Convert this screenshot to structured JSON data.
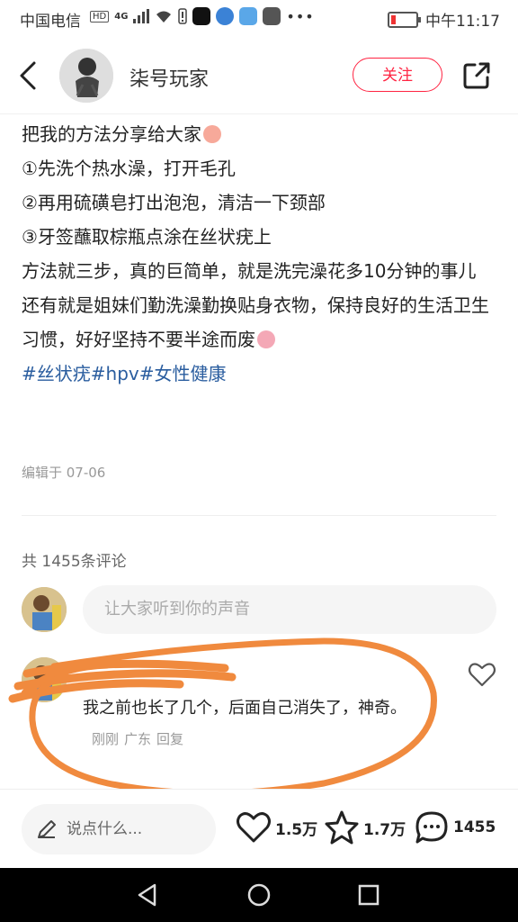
{
  "status_bar": {
    "carrier": "中国电信",
    "hd": "HD",
    "network": "4G",
    "time": "中午11:17"
  },
  "header": {
    "username": "柒号玩家",
    "follow_label": "关注"
  },
  "post": {
    "lines": [
      "把我的方法分享给大家",
      "①先洗个热水澡，打开毛孔",
      "②再用硫磺皂打出泡泡，清洁一下颈部",
      "③牙签蘸取棕瓶点涂在丝状疣上",
      "方法就三步，真的巨简单，就是洗完澡花多10分钟的事儿",
      "还有就是姐妹们勤洗澡勤换贴身衣物，保持良好的生活卫生习惯，好好坚持不要半途而废"
    ],
    "hashtags": "#丝状疣#hpv#女性健康",
    "edit_date": "编辑于 07-06"
  },
  "comments": {
    "count_label": "共 1455条评论",
    "input_placeholder": "让大家听到你的声音",
    "items": [
      {
        "text": "我之前也长了几个，后面自己消失了，神奇。",
        "time": "刚刚",
        "location": "广东",
        "reply": "回复"
      }
    ]
  },
  "bottom_bar": {
    "say_placeholder": "说点什么...",
    "likes": "1.5万",
    "favorites": "1.7万",
    "comments": "1455"
  },
  "colors": {
    "accent": "#ff2442",
    "hashtag": "#2a5d9f",
    "scribble": "#f08a3e"
  }
}
